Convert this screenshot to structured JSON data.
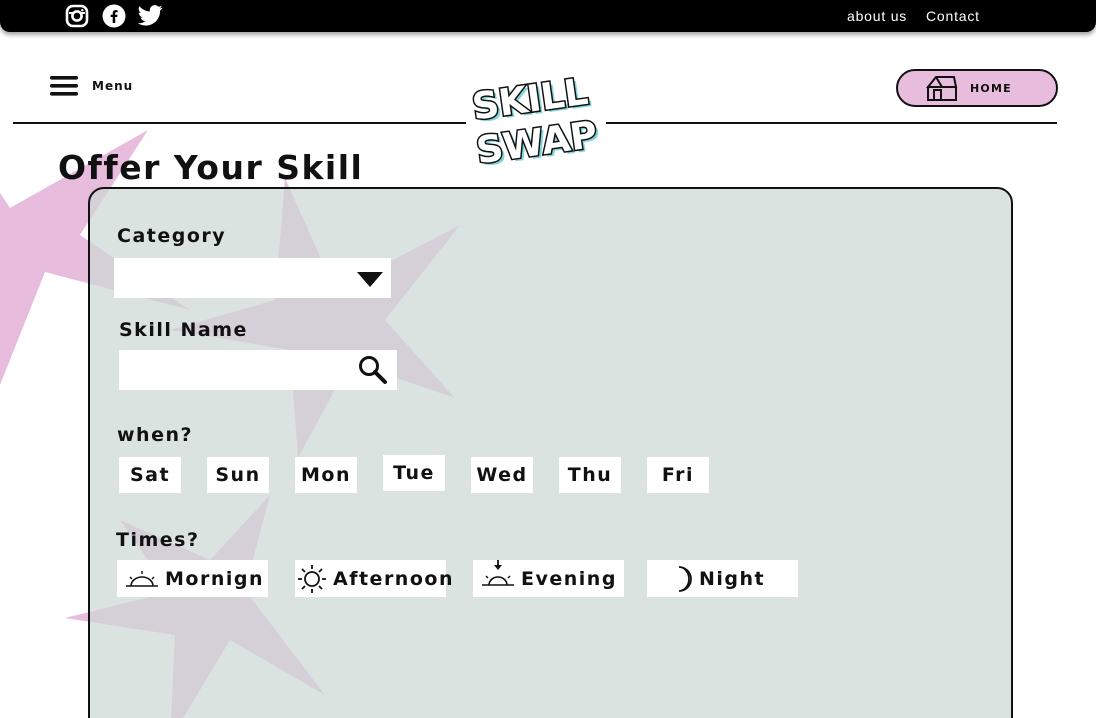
{
  "topbar": {
    "social": [
      {
        "icon": "instagram-icon"
      },
      {
        "icon": "facebook-icon"
      },
      {
        "icon": "twitter-icon"
      }
    ],
    "links": [
      "about us",
      "Contact"
    ]
  },
  "header": {
    "menu_label": "Menu",
    "menu_icon": "hamburger-icon",
    "logo_text": [
      "SKILL",
      "SWAP"
    ],
    "home_label": "HOME",
    "home_icon": "house-icon"
  },
  "page": {
    "title": "Offer Your Skill"
  },
  "form": {
    "category_label": "Category",
    "category_value": "",
    "skill_label": "Skill Name",
    "skill_value": "",
    "when_label": "when?",
    "days": [
      "Sat",
      "Sun",
      "Mon",
      "Tue",
      "Wed",
      "Thu",
      "Fri"
    ],
    "times_label": "Times?",
    "times": [
      {
        "label": "Mornign",
        "icon": "sunrise-icon"
      },
      {
        "label": "Afternoon",
        "icon": "sun-icon"
      },
      {
        "label": "Evening",
        "icon": "sunset-icon"
      },
      {
        "label": "Night",
        "icon": "moon-icon"
      }
    ]
  },
  "colors": {
    "topbar": "#000000",
    "home_button": "#e8bcdc",
    "panel": "#d8e0df",
    "star_pink": "#e8bcdc",
    "logo_accent": "#7fd6dc"
  }
}
